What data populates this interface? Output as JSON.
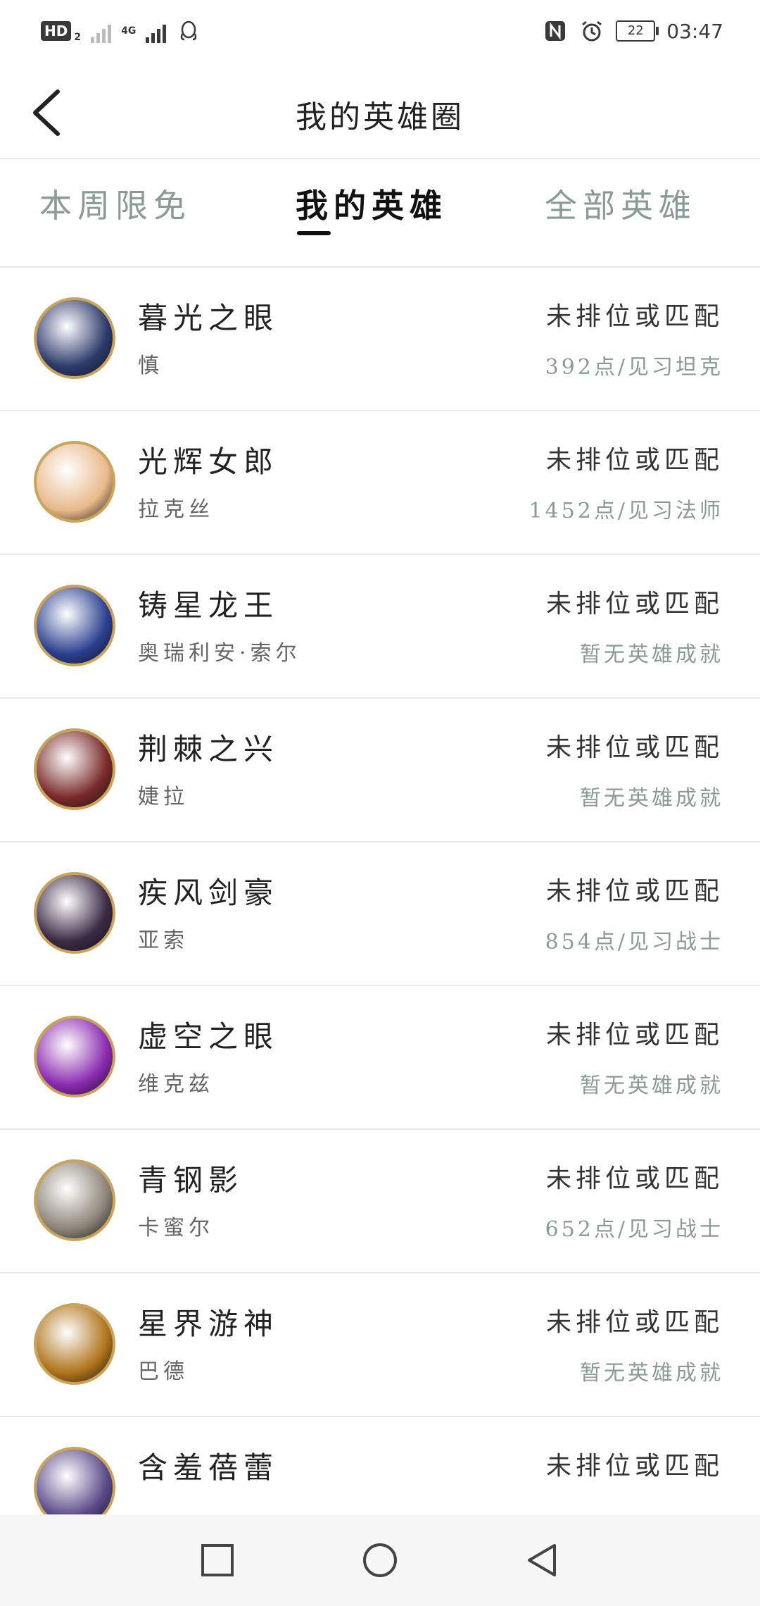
{
  "status_bar": {
    "hd_label": "HD",
    "sim_index": "2",
    "network_type": "4G",
    "battery_level": "22",
    "time": "03:47"
  },
  "header": {
    "title": "我的英雄圈"
  },
  "tabs": [
    {
      "label": "本周限免",
      "selected": false
    },
    {
      "label": "我的英雄",
      "selected": true
    },
    {
      "label": "全部英雄",
      "selected": false
    }
  ],
  "heroes": [
    {
      "title": "暮光之眼",
      "name": "慎",
      "rank": "未排位或匹配",
      "mastery": "392点/见习坦克",
      "avatar_color": "#2c3a6b"
    },
    {
      "title": "光辉女郎",
      "name": "拉克丝",
      "rank": "未排位或匹配",
      "mastery": "1452点/见习法师",
      "avatar_color": "#e9b98a"
    },
    {
      "title": "铸星龙王",
      "name": "奥瑞利安·索尔",
      "rank": "未排位或匹配",
      "mastery": "暂无英雄成就",
      "avatar_color": "#2b3f8f"
    },
    {
      "title": "荆棘之兴",
      "name": "婕拉",
      "rank": "未排位或匹配",
      "mastery": "暂无英雄成就",
      "avatar_color": "#7a2a2a"
    },
    {
      "title": "疾风剑豪",
      "name": "亚索",
      "rank": "未排位或匹配",
      "mastery": "854点/见习战士",
      "avatar_color": "#3a2a44"
    },
    {
      "title": "虚空之眼",
      "name": "维克兹",
      "rank": "未排位或匹配",
      "mastery": "暂无英雄成就",
      "avatar_color": "#8a2ab0"
    },
    {
      "title": "青钢影",
      "name": "卡蜜尔",
      "rank": "未排位或匹配",
      "mastery": "652点/见习战士",
      "avatar_color": "#8c8478"
    },
    {
      "title": "星界游神",
      "name": "巴德",
      "rank": "未排位或匹配",
      "mastery": "暂无英雄成就",
      "avatar_color": "#b0741c"
    },
    {
      "title": "含羞蓓蕾",
      "name": "",
      "rank": "未排位或匹配",
      "mastery": "",
      "avatar_color": "#5a4a8a"
    }
  ],
  "icons": {
    "back": "back-arrow-icon",
    "nav_recent": "square-icon",
    "nav_home": "circle-icon",
    "nav_back": "triangle-back-icon"
  }
}
